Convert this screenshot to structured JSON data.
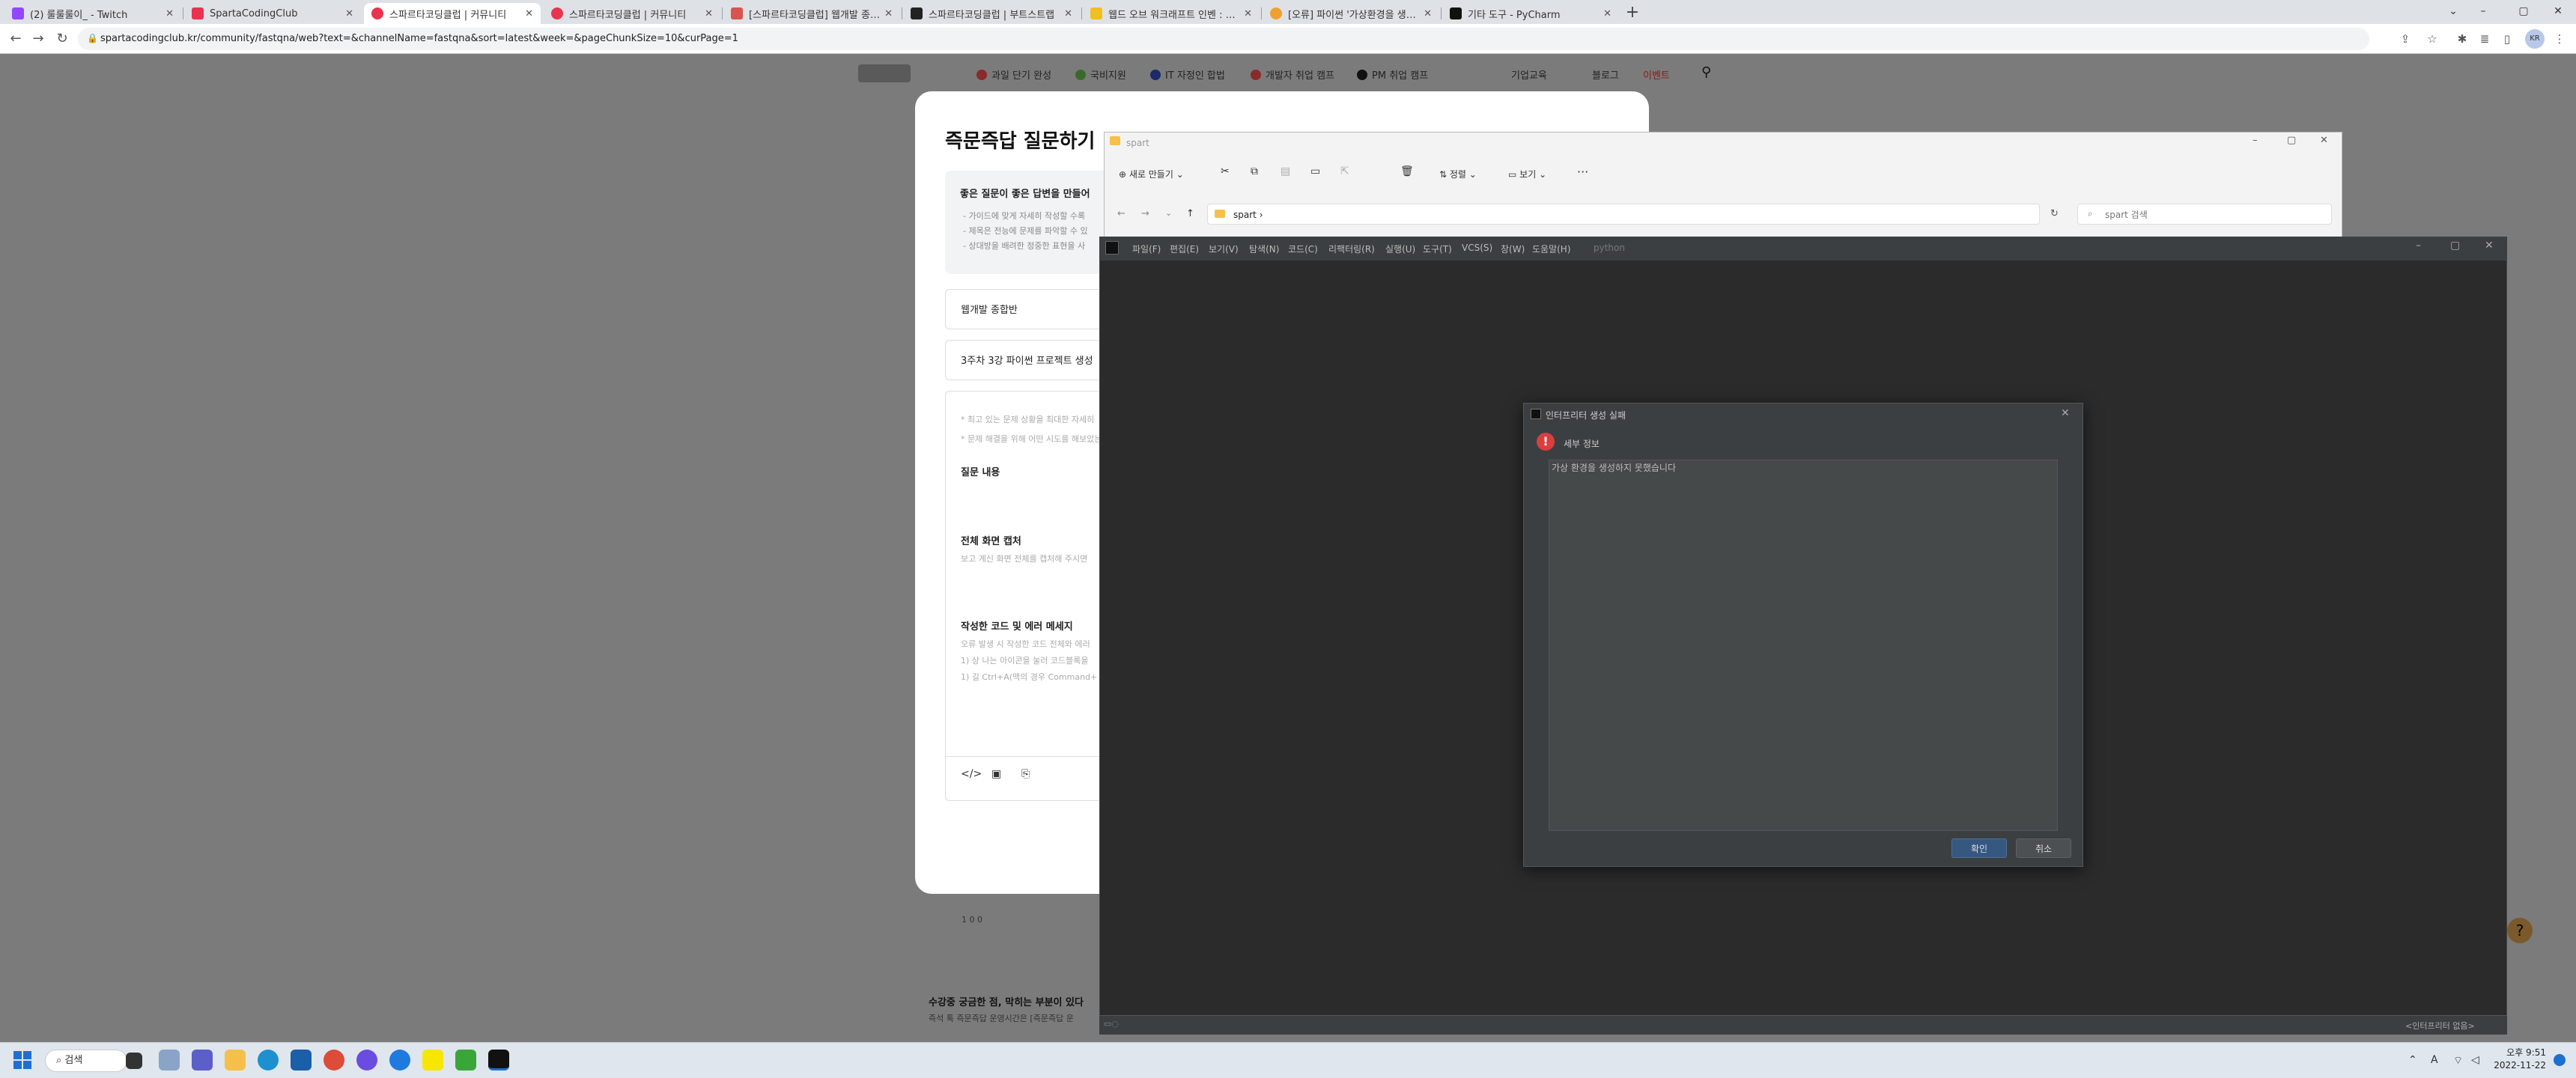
{
  "browser": {
    "tabs": [
      {
        "title": "(2) 룰룰룰이_ - Twitch",
        "color": "#9146ff"
      },
      {
        "title": "SpartaCodingClub",
        "color": "#e8344e"
      },
      {
        "title": "스파르타코딩클럽 | 커뮤니티",
        "color": "#e8344e"
      },
      {
        "title": "스파르타코딩클럽 | 커뮤니티",
        "color": "#e8344e"
      },
      {
        "title": "[스파르타코딩클럽] 웹개발 종합반",
        "color": "#d9534f"
      },
      {
        "title": "스파르타코딩클럽 | 부트스트랩",
        "color": "#222222"
      },
      {
        "title": "웹드 오브 워크래프트 인벤 : 드...",
        "color": "#f0c020"
      },
      {
        "title": "[오류] 파이썬 '가상환경을 생성하...",
        "color": "#f0a030"
      },
      {
        "title": "기타 도구 - PyCharm",
        "color": "#111111"
      }
    ],
    "new_tab": "+",
    "url": "spartacodingclub.kr/community/fastqna/web?text=&channelName=fastqna&sort=latest&week=&pageChunkSize=10&curPage=1",
    "profile": "KR"
  },
  "site": {
    "nav": [
      "과일 단기 완성",
      "국비지원",
      "IT 자정인 합법",
      "개발자 취업 캠프",
      "PM 취업 캠프",
      "기업교육",
      "블로그",
      "이벤트"
    ],
    "modal_title": "즉문즉답 질문하기",
    "guide_title": "좋은 질문이 좋은 답변을 만들어",
    "guide_lines": [
      "- 가이드에 맞게 자세히 작성할 수록",
      "- 제목은 전능에 문제를 파악할 수 있",
      "- 상대방을 배려한 정중한 표현을 사"
    ],
    "field_course": "웹개발 종합반",
    "field_title": "3주차 3강 파이썬 프로젝트 생성",
    "editor_hint1": "* 최고 있는 문제 상황을 최대한 자세히",
    "editor_hint2": "* 문제 해결을 위해 어떤 시도를 해보았는",
    "q_content": "질문 내용",
    "fullscreen_title": "전체 화면 캡처",
    "fullscreen_hint": "보고 계신 화면 전체를 캡처해 주시면",
    "code_title": "작성한 코드 및 에러 메세지",
    "code_hint1": "오류 발생 시 작성한 코드 전체와 에러",
    "code_hint2": "1) 상 나는 아이콘을 눌러 코드블록을",
    "code_hint3": "1) 길 Ctrl+A(맥의 경우 Command+",
    "stats": "1   0   0",
    "bottom_title": "수강중 궁금한 점, 막히는 부분이 있다",
    "bottom_sub": "즉석 톡 즉문즉답 운영시간은 [즉문즉답 운"
  },
  "explorer": {
    "title": "spart",
    "new_label": "새로 만들기",
    "sort_label": "정렬",
    "view_label": "보기",
    "more": "···",
    "path": "spart",
    "search_placeholder": "spart 검색"
  },
  "pycharm": {
    "menu": [
      "파일(F)",
      "편집(E)",
      "보기(V)",
      "탐색(N)",
      "코드(C)",
      "리팩터링(R)",
      "실행(U)",
      "도구(T)",
      "VCS(S)",
      "창(W)",
      "도움말(H)"
    ],
    "project": "python",
    "status_right": "<인터프리터 없음>"
  },
  "dialog": {
    "title": "인터프리터 생성 실패",
    "detail_label": "세부 정보",
    "message": "가상 환경을 생성하지 못했습니다",
    "ok": "확인",
    "cancel": "취소"
  },
  "taskbar": {
    "search": "검색",
    "clock_time": "오후 9:51",
    "clock_date": "2022-11-22",
    "lang": "A"
  }
}
